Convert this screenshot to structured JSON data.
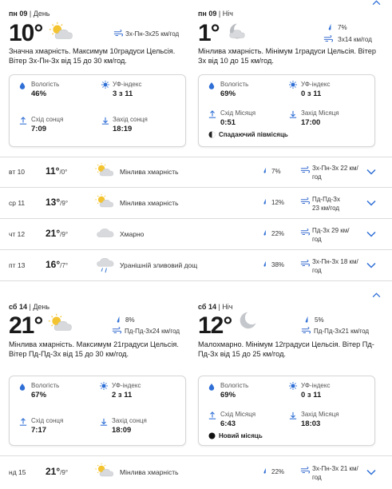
{
  "block1": {
    "day": {
      "date": "пн 09",
      "part": "День",
      "temp": "10°",
      "wind": "Зх-Пн-Зх25 км/год",
      "desc": "Значна хмарність. Максимум 10градуси Цельсія. Вітер Зх-Пн-Зх від 15 до 30 км/год.",
      "humidity_label": "Вологість",
      "humidity": "46%",
      "uv_label": "УФ-індекс",
      "uv": "3 з 11",
      "rise_label": "Схід сонця",
      "rise": "7:09",
      "set_label": "Захід сонця",
      "set": "18:19"
    },
    "night": {
      "date": "пн 09",
      "part": "Ніч",
      "temp": "1°",
      "precip": "7%",
      "wind": "Зх14 км/год",
      "desc": "Мінлива хмарність. Мінімум 1градуси Цельсія. Вітер Зх від 10 до 15 км/год.",
      "humidity_label": "Вологість",
      "humidity": "69%",
      "uv_label": "УФ-індекс",
      "uv": "0 з 11",
      "rise_label": "Схід Місяця",
      "rise": "0:51",
      "set_label": "Захід Місяця",
      "set": "17:00",
      "moon_phase": "Спадаючий півмісяць"
    }
  },
  "rows": [
    {
      "date": "вт 10",
      "hi": "11°",
      "lo": "/0°",
      "desc": "Мінлива хмарність",
      "pct": "7%",
      "wind": [
        "Зх-Пн-Зх 22 км/",
        "год"
      ]
    },
    {
      "date": "ср 11",
      "hi": "13°",
      "lo": "/9°",
      "desc": "Мінлива хмарність",
      "pct": "12%",
      "wind": [
        "Пд-Пд-Зх",
        "23 км/год"
      ]
    },
    {
      "date": "чт 12",
      "hi": "21°",
      "lo": "/9°",
      "desc": "Хмарно",
      "pct": "22%",
      "wind": [
        "Пд-Зх 29 км/",
        "год"
      ]
    },
    {
      "date": "пт 13",
      "hi": "16°",
      "lo": "/7°",
      "desc": "Уранішній зливовий дощ",
      "pct": "38%",
      "wind": [
        "Зх-Пн-Зх 18 км/",
        "год"
      ]
    }
  ],
  "block2": {
    "day": {
      "date": "сб 14",
      "part": "День",
      "temp": "21°",
      "precip": "8%",
      "wind": "Пд-Пд-Зх24 км/год",
      "desc": "Мінлива хмарність. Максимум 21градуси Цельсія. Вітер Пд-Пд-Зх від 15 до 30 км/год.",
      "humidity_label": "Вологість",
      "humidity": "67%",
      "uv_label": "УФ-індекс",
      "uv": "2 з 11",
      "rise_label": "Схід сонця",
      "rise": "7:17",
      "set_label": "Захід сонця",
      "set": "18:09"
    },
    "night": {
      "date": "сб 14",
      "part": "Ніч",
      "temp": "12°",
      "precip": "5%",
      "wind": "Пд-Пд-Зх21 км/год",
      "desc": "Малохмарно. Мінімум 12градуси Цельсія. Вітер Пд-Пд-Зх від 15 до 25 км/год.",
      "humidity_label": "Вологість",
      "humidity": "69%",
      "uv_label": "УФ-індекс",
      "uv": "0 з 11",
      "rise_label": "Схід Місяця",
      "rise": "6:43",
      "set_label": "Захід Місяця",
      "set": "18:03",
      "moon_phase": "Новий місяць"
    }
  },
  "row_last": {
    "date": "нд 15",
    "hi": "21°",
    "lo": "/9°",
    "desc": "Мінлива хмарність",
    "pct": "22%",
    "wind": [
      "Зх-Пн-Зх 21 км/",
      "год"
    ]
  }
}
